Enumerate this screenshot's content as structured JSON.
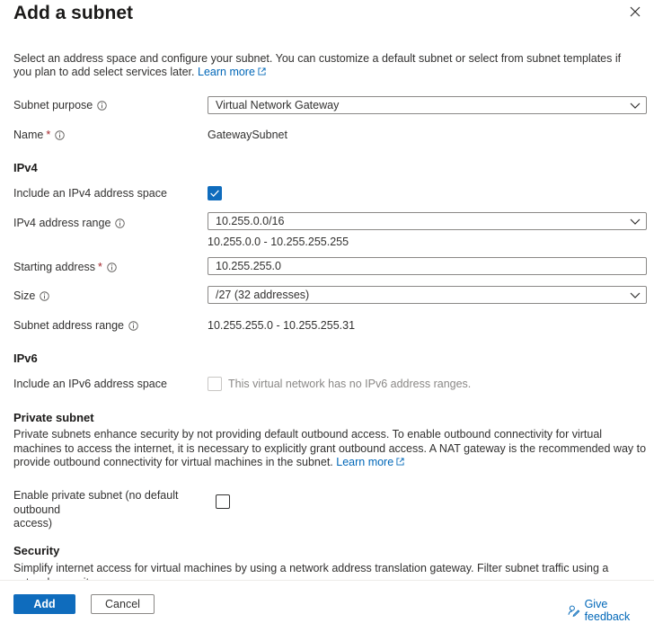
{
  "header": {
    "title": "Add a subnet"
  },
  "intro": {
    "text": "Select an address space and configure your subnet. You can customize a default subnet or select from subnet templates if you plan to add select services later.",
    "learn_more": "Learn more"
  },
  "fields": {
    "subnet_purpose": {
      "label": "Subnet purpose",
      "value": "Virtual Network Gateway"
    },
    "name": {
      "label": "Name",
      "required": "*",
      "value": "GatewaySubnet"
    }
  },
  "ipv4": {
    "heading": "IPv4",
    "include_label": "Include an IPv4 address space",
    "include_checked": true,
    "range_label": "IPv4 address range",
    "range_value": "10.255.0.0/16",
    "range_hint": "10.255.0.0 - 10.255.255.255",
    "start_label": "Starting address",
    "start_required": "*",
    "start_value": "10.255.255.0",
    "size_label": "Size",
    "size_value": "/27 (32 addresses)",
    "subnet_range_label": "Subnet address range",
    "subnet_range_value": "10.255.255.0 - 10.255.255.31"
  },
  "ipv6": {
    "heading": "IPv6",
    "include_label": "Include an IPv6 address space",
    "include_checked": false,
    "disabled_note": "This virtual network has no IPv6 address ranges."
  },
  "private_subnet": {
    "heading": "Private subnet",
    "text": "Private subnets enhance security by not providing default outbound access. To enable outbound connectivity for virtual machines to access the internet, it is necessary to explicitly grant outbound access. A NAT gateway is the recommended way to provide outbound connectivity for virtual machines in the subnet.",
    "learn_more": "Learn more",
    "enable_label_line1": "Enable private subnet (no default outbound",
    "enable_label_line2": "access)",
    "enable_checked": false
  },
  "security": {
    "heading": "Security",
    "text": "Simplify internet access for virtual machines by using a network address translation gateway. Filter subnet traffic using a network security"
  },
  "footer": {
    "add_label": "Add",
    "cancel_label": "Cancel",
    "feedback_label": "Give feedback"
  },
  "colors": {
    "accent": "#0f6cbd",
    "link": "#0067b8",
    "required": "#a4262c"
  }
}
